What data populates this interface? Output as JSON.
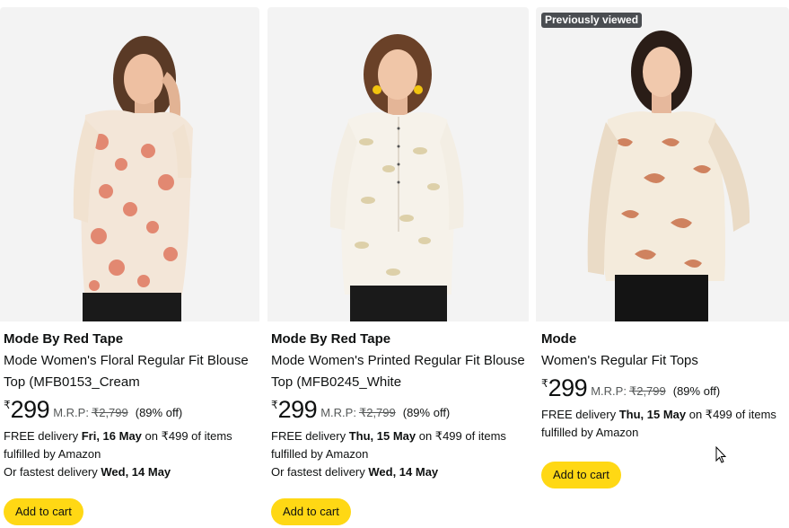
{
  "products": [
    {
      "badge": "",
      "brand": "Mode By Red Tape",
      "title": "Mode Women's Floral Regular Fit Blouse Top (MFB0153_Cream",
      "currency": "₹",
      "price": "299",
      "mrp_label": "M.R.P:",
      "mrp": "₹2,799",
      "discount": "(89% off)",
      "delivery_prefix": "FREE delivery ",
      "delivery_date": "Fri, 16 May",
      "delivery_suffix": " on ₹499 of items fulfilled by Amazon",
      "fastest_prefix": "Or fastest delivery ",
      "fastest_date": "Wed, 14 May",
      "cart_label": "Add to cart",
      "image_icon": "floral-blouse-model-image"
    },
    {
      "badge": "",
      "brand": "Mode By Red Tape",
      "title": "Mode Women's Printed Regular Fit Blouse Top (MFB0245_White",
      "currency": "₹",
      "price": "299",
      "mrp_label": "M.R.P:",
      "mrp": "₹2,799",
      "discount": "(89% off)",
      "delivery_prefix": "FREE delivery ",
      "delivery_date": "Thu, 15 May",
      "delivery_suffix": " on ₹499 of items fulfilled by Amazon",
      "fastest_prefix": "Or fastest delivery ",
      "fastest_date": "Wed, 14 May",
      "cart_label": "Add to cart",
      "image_icon": "printed-blouse-model-image"
    },
    {
      "badge": "Previously viewed",
      "brand": "Mode",
      "title": "Women's Regular Fit Tops",
      "currency": "₹",
      "price": "299",
      "mrp_label": "M.R.P:",
      "mrp": "₹2,799",
      "discount": "(89% off)",
      "delivery_prefix": "FREE delivery ",
      "delivery_date": "Thu, 15 May",
      "delivery_suffix": " on ₹499 of items fulfilled by Amazon",
      "fastest_prefix": "",
      "fastest_date": "",
      "cart_label": "Add to cart",
      "image_icon": "regular-fit-top-model-image"
    }
  ],
  "colors": {
    "cart_button": "#ffd814",
    "badge_bg": "#4a4d51",
    "image_bg": "#f3f3f3",
    "muted_text": "#565959"
  }
}
